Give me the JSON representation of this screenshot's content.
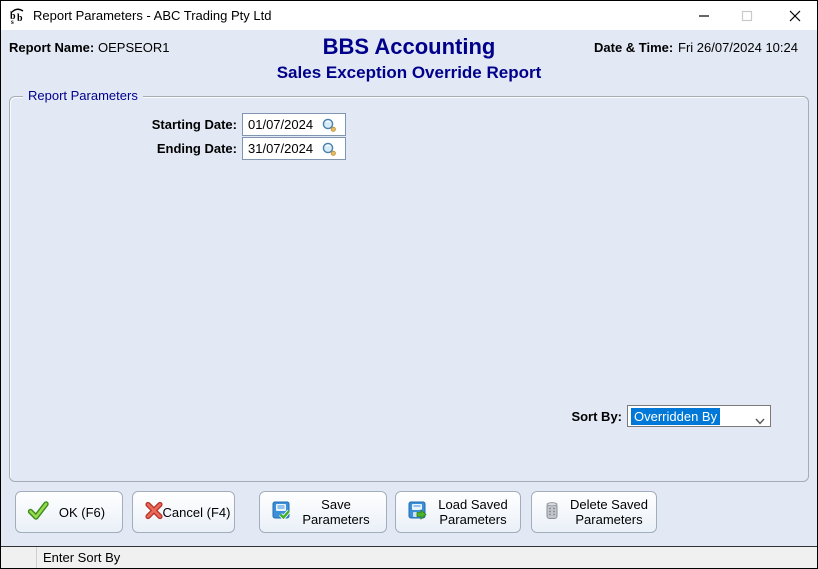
{
  "window": {
    "title": "Report Parameters - ABC Trading Pty Ltd"
  },
  "header": {
    "report_name_label": "Report Name:",
    "report_name_value": "OEPSEOR1",
    "app_title": "BBS Accounting",
    "report_title": "Sales Exception Override Report",
    "datetime_label": "Date & Time:",
    "datetime_value": "Fri 26/07/2024 10:24"
  },
  "parameters": {
    "group_label": "Report Parameters",
    "fields": [
      {
        "label": "Starting Date:",
        "value": "01/07/2024",
        "icon": "magnifier-icon"
      },
      {
        "label": "Ending Date:",
        "value": "31/07/2024",
        "icon": "magnifier-icon"
      }
    ],
    "sort_by": {
      "label": "Sort By:",
      "value": "Overridden By"
    }
  },
  "buttons": [
    {
      "label": "OK (F6)",
      "icon": "green-check-icon"
    },
    {
      "label": "Cancel (F4)",
      "icon": "red-cross-icon"
    },
    {
      "label": "Save Parameters",
      "icon": "save-disk-icon"
    },
    {
      "label": "Load Saved Parameters",
      "icon": "load-disk-arrow-icon"
    },
    {
      "label": "Delete Saved Parameters",
      "icon": "trash-can-icon"
    }
  ],
  "status_bar": {
    "message": "Enter Sort By"
  },
  "colors": {
    "heading_navy": "#00008b",
    "selection_blue": "#0078d7",
    "panel_blue": "#e2e9f4",
    "input_border": "#7f95b2",
    "ok_green": "#56b232",
    "cancel_red": "#e0544a",
    "status_gray": "#f0f0f0"
  }
}
